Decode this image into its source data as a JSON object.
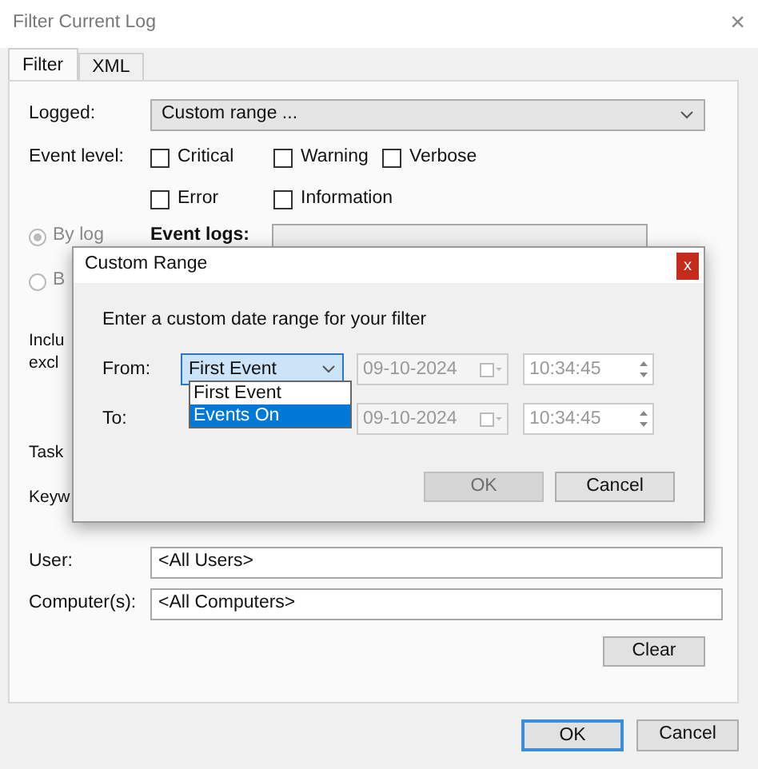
{
  "window": {
    "title": "Filter Current Log",
    "close": "×"
  },
  "tabs": [
    {
      "label": "Filter",
      "selected": true
    },
    {
      "label": "XML",
      "selected": false
    }
  ],
  "logged": {
    "label": "Logged:",
    "value": "Custom range ..."
  },
  "event_level": {
    "label": "Event level:",
    "rows": [
      {
        "options": [
          {
            "label": "Critical",
            "checked": false
          },
          {
            "label": "Warning",
            "checked": false
          },
          {
            "label": "Verbose",
            "checked": false
          }
        ]
      },
      {
        "options": [
          {
            "label": "Error",
            "checked": false
          },
          {
            "label": "Information",
            "checked": false
          }
        ]
      }
    ]
  },
  "sources": [
    {
      "label": "By log",
      "selected": true,
      "field_label": "Event logs:"
    },
    {
      "label": "B",
      "selected": false
    }
  ],
  "include_exclude_lines": [
    "Inclu",
    "excl"
  ],
  "task_label": "Task",
  "keywords_label": "Keyw",
  "user": {
    "label": "User:",
    "value": "<All Users>"
  },
  "computer": {
    "label": "Computer(s):",
    "value": "<All Computers>"
  },
  "clear_button": "Clear",
  "buttons": [
    {
      "label": "OK",
      "default": true
    },
    {
      "label": "Cancel",
      "default": false
    }
  ],
  "custom_range": {
    "title": "Custom Range",
    "close": "x",
    "prompt": "Enter a custom date range for your filter",
    "from": {
      "label": "From:",
      "select": "First Event",
      "date": "09-10-2024",
      "time": "10:34:45"
    },
    "dropdown": [
      {
        "label": "First Event",
        "selected": false
      },
      {
        "label": "Events On",
        "selected": true
      }
    ],
    "to": {
      "label": "To:",
      "date": "09-10-2024",
      "time": "10:34:45"
    },
    "buttons": [
      {
        "label": "OK",
        "disabled": true
      },
      {
        "label": "Cancel",
        "disabled": false
      }
    ]
  }
}
